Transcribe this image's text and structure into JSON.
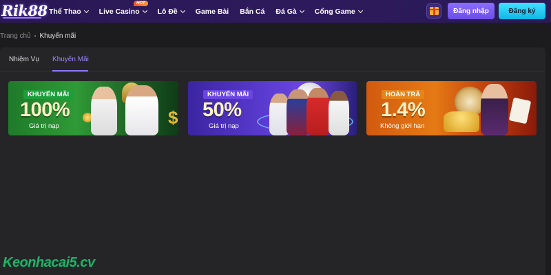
{
  "header": {
    "logo": "Rik88",
    "menu": [
      {
        "label": "Thể Thao",
        "dropdown": true
      },
      {
        "label": "Live Casino",
        "dropdown": true,
        "badge": "HOT"
      },
      {
        "label": "Lô Đề",
        "dropdown": true
      },
      {
        "label": "Game Bài",
        "dropdown": false
      },
      {
        "label": "Bắn Cá",
        "dropdown": false
      },
      {
        "label": "Đá Gà",
        "dropdown": true
      },
      {
        "label": "Cổng Game",
        "dropdown": true
      }
    ],
    "login_label": "Đăng nhập",
    "register_label": "Đăng ký",
    "gift_icon": "gift-icon"
  },
  "breadcrumb": {
    "home": "Trang chủ",
    "current": "Khuyến mãi"
  },
  "tabs": [
    {
      "label": "Nhiệm Vụ",
      "active": false
    },
    {
      "label": "Khuyến Mãi",
      "active": true
    }
  ],
  "promos": [
    {
      "tag": "KHUYẾN MÃI",
      "value": "100%",
      "sub": "Giá trị nạp"
    },
    {
      "tag": "KHUYẾN MÃI",
      "value": "50%",
      "sub": "Giá trị nạp"
    },
    {
      "tag": "HOÀN TRẢ",
      "value": "1.4%",
      "sub": "Không giới hạn"
    }
  ],
  "watermark": "Keonhacai5.cv",
  "colors": {
    "nav_bg": "#2a1855",
    "accent_purple": "#8f76ff",
    "register_cyan": "#12b5e6",
    "panel_bg": "#252527",
    "page_bg": "#1c1c1e"
  }
}
